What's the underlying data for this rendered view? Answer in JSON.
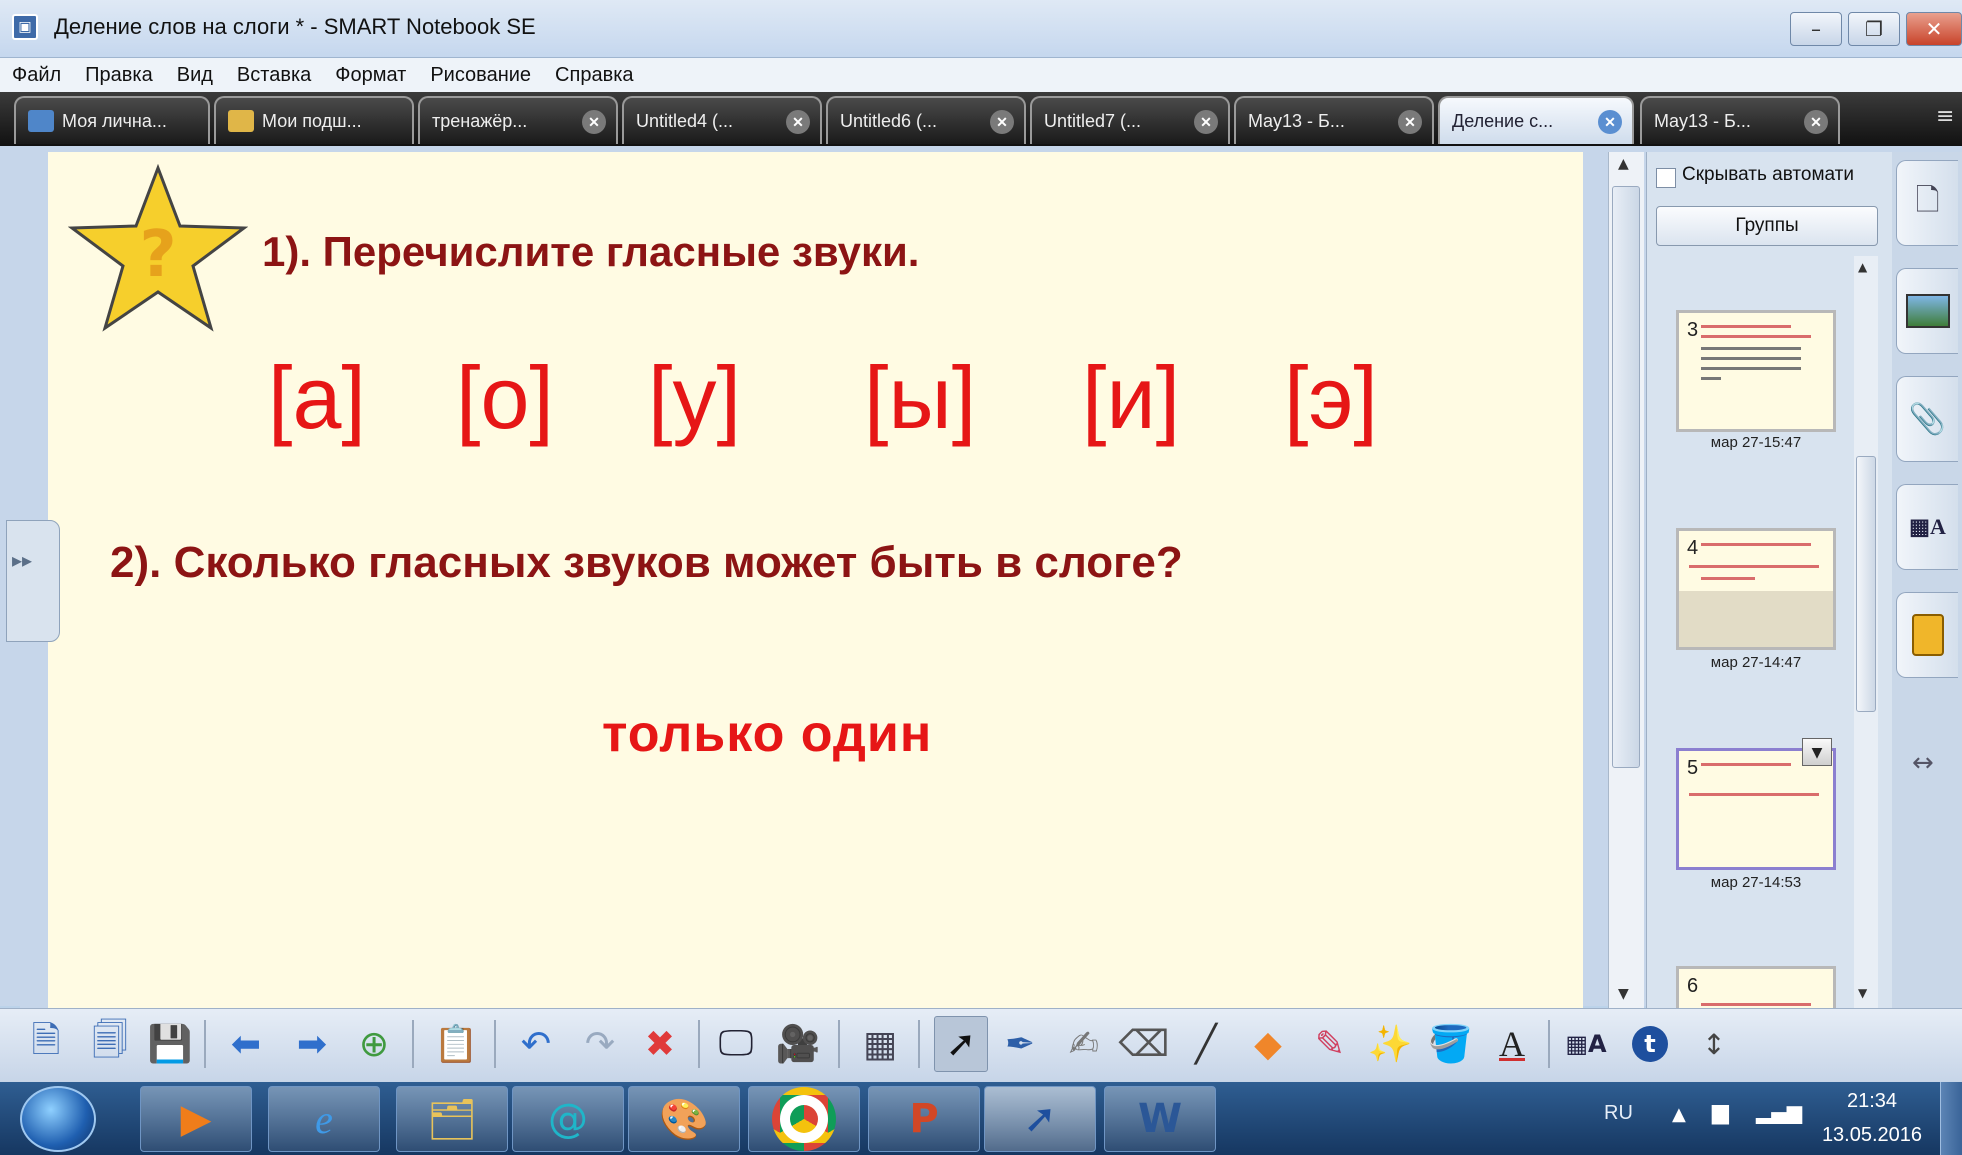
{
  "window": {
    "title": "Деление слов на слоги * - SMART Notebook SE",
    "minimize": "–",
    "maximize": "❐",
    "close": "✕"
  },
  "menu": [
    "Файл",
    "Правка",
    "Вид",
    "Вставка",
    "Формат",
    "Рисование",
    "Справка"
  ],
  "tabs": [
    {
      "label": "Моя лична...",
      "active": false,
      "closable": false
    },
    {
      "label": "Мои подш...",
      "active": false,
      "closable": false
    },
    {
      "label": "тренажёр...",
      "active": false,
      "closable": true
    },
    {
      "label": "Untitled4 (...",
      "active": false,
      "closable": true
    },
    {
      "label": "Untitled6 (...",
      "active": false,
      "closable": true
    },
    {
      "label": "Untitled7 (...",
      "active": false,
      "closable": true
    },
    {
      "label": "May13 - Б...",
      "active": false,
      "closable": true
    },
    {
      "label": "Деление с...",
      "active": true,
      "closable": true
    },
    {
      "label": "May13 - Б...",
      "active": false,
      "closable": true
    }
  ],
  "page": {
    "question1": "1). Перечислите гласные звуки.",
    "vowels": [
      "[а]",
      "[о]",
      "[у]",
      "[ы]",
      "[и]",
      "[э]"
    ],
    "question2": "2). Сколько гласных звуков может быть в слоге?",
    "answer": "только один"
  },
  "sidepanel": {
    "autohide_label": "Скрывать автомати",
    "groups_button": "Группы",
    "thumbnails": [
      {
        "number": "3",
        "date": "мар 27-15:47"
      },
      {
        "number": "4",
        "date": "мар 27-14:47"
      },
      {
        "number": "5",
        "date": "мар 27-14:53"
      },
      {
        "number": "6",
        "date": ""
      }
    ]
  },
  "taskbar": {
    "language": "RU",
    "time": "21:34",
    "date": "13.05.2016"
  },
  "colors": {
    "question": "#8c1414",
    "highlight": "#e61616",
    "canvas": "#fffbe3"
  }
}
